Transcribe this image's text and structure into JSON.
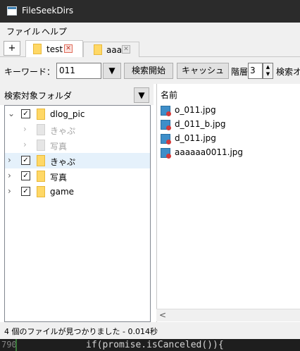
{
  "window": {
    "title": "FileSeekDirs",
    "icon": "app-icon"
  },
  "menu": [
    "ファイル",
    "ヘルプ"
  ],
  "tabs": {
    "add_label": "+",
    "items": [
      {
        "label": "test",
        "active": true,
        "close_color": "#e06c5a"
      },
      {
        "label": "aaa",
        "active": false,
        "close_color": "#b0b0b0"
      }
    ]
  },
  "toolbar": {
    "keyword_label": "キーワード：",
    "keyword_value": "011",
    "dropdown_glyph": "▼",
    "search_button": "検索開始",
    "cache_button": "キャッシュ",
    "depth_label": "階層",
    "depth_value": "3",
    "options_label": "検索オ"
  },
  "left_panel": {
    "header": "検索対象フォルダ",
    "dropdown_glyph": "▼",
    "tree": [
      {
        "label": "dlog_pic",
        "expanded": true,
        "checked": true,
        "enabled": true
      },
      {
        "label": "きゃぷ",
        "indent": 1,
        "checked": false,
        "enabled": false
      },
      {
        "label": "写真",
        "indent": 1,
        "checked": false,
        "enabled": false
      },
      {
        "label": "きゃぷ",
        "checked": true,
        "enabled": true,
        "selected": true
      },
      {
        "label": "写真",
        "checked": true,
        "enabled": true
      },
      {
        "label": "game",
        "checked": true,
        "enabled": true
      }
    ]
  },
  "right_panel": {
    "column_header": "名前",
    "files": [
      "o_011.jpg",
      "d_011_b.jpg",
      "d_011.jpg",
      "aaaaaa0011.jpg"
    ],
    "scroll_left_glyph": "<"
  },
  "status": {
    "text": "4 個のファイルが見つかりました - 0.014秒"
  },
  "background_editor": {
    "line_number": "790",
    "code": "if(promise.isCanceled()){"
  },
  "colors": {
    "titlebar": "#2b2b2b",
    "folder": "#ffd866",
    "selection": "#e5f1fb",
    "file_icon": "#3e8ec9"
  }
}
